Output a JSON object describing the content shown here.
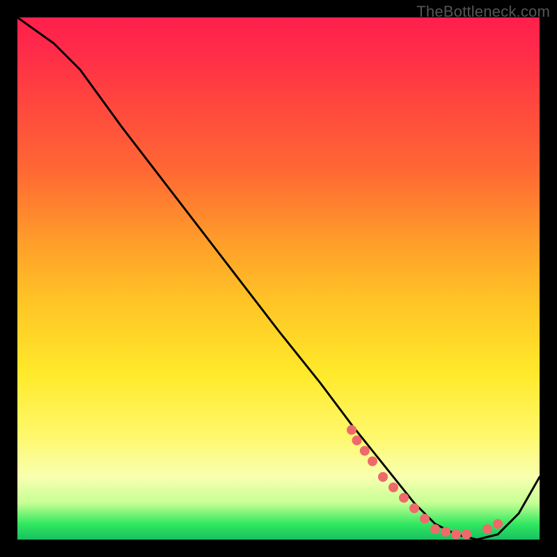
{
  "watermark": "TheBottleneck.com",
  "chart_data": {
    "type": "line",
    "title": "",
    "xlabel": "",
    "ylabel": "",
    "xlim": [
      0,
      100
    ],
    "ylim": [
      0,
      100
    ],
    "series": [
      {
        "name": "curve",
        "x": [
          0,
          7,
          12,
          20,
          30,
          40,
          50,
          58,
          64,
          68,
          72,
          76,
          80,
          84,
          88,
          92,
          96,
          100
        ],
        "y": [
          100,
          95,
          90,
          79,
          66,
          53,
          40,
          30,
          22,
          17,
          12,
          7,
          3,
          1,
          0,
          1,
          5,
          12
        ]
      }
    ],
    "markers": {
      "name": "dots",
      "color": "#ee6a6a",
      "x": [
        64,
        65,
        66.5,
        68,
        70,
        72,
        74,
        76,
        78,
        80,
        82,
        84,
        86,
        90,
        92
      ],
      "y": [
        21,
        19,
        17,
        15,
        12,
        10,
        8,
        6,
        4,
        2,
        1.5,
        1,
        1,
        2,
        3
      ]
    },
    "colors": {
      "curve": "#000000",
      "marker": "#ee6a6a",
      "gradient_top": "#ff1f4b",
      "gradient_bottom": "#18c060"
    }
  }
}
